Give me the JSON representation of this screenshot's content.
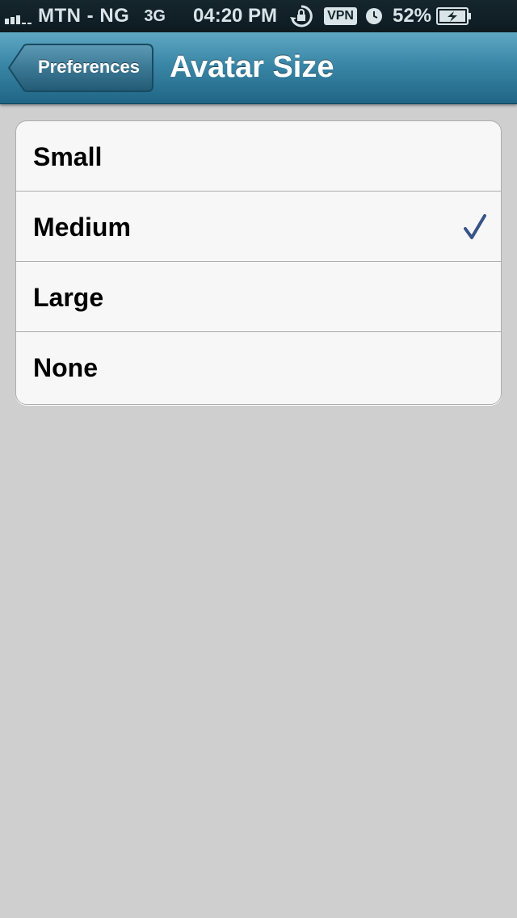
{
  "status_bar": {
    "carrier": "MTN - NG",
    "network": "3G",
    "time": "04:20 PM",
    "vpn": "VPN",
    "battery": "52%",
    "icons": [
      "signal-icon",
      "rotation-lock-icon",
      "vpn-icon",
      "alarm-clock-icon",
      "battery-charging-icon"
    ]
  },
  "nav": {
    "back_label": "Preferences",
    "title": "Avatar Size"
  },
  "options": [
    {
      "label": "Small",
      "selected": false
    },
    {
      "label": "Medium",
      "selected": true
    },
    {
      "label": "Large",
      "selected": false
    },
    {
      "label": "None",
      "selected": false
    }
  ],
  "colors": {
    "nav_bar": "#3a86a6",
    "checkmark": "#385487",
    "background": "#cfcfcf"
  }
}
